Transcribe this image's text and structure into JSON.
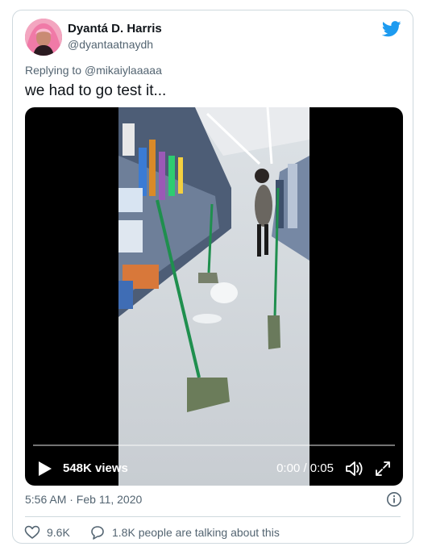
{
  "tweet": {
    "display_name": "Dyantá D. Harris",
    "handle": "@dyantaatnaydh",
    "reply_prefix": "Replying to",
    "reply_to": "@mikaiylaaaaa",
    "text": "we had to go test it...",
    "timestamp": "5:56 AM · Feb 11, 2020",
    "likes": "9.6K",
    "conversation": "1.8K people are talking about this"
  },
  "video": {
    "views": "548K views",
    "time": "0:00 / 0:05",
    "progress_fraction": 0
  },
  "colors": {
    "twitter_blue": "#1d9bf0",
    "muted_text": "#536471",
    "border": "#cfd9de"
  },
  "icons": {
    "brand": "twitter-bird-icon",
    "play": "play-icon",
    "volume": "volume-icon",
    "fullscreen": "fullscreen-icon",
    "info": "info-icon",
    "like": "heart-icon",
    "reply": "speech-bubble-icon"
  }
}
